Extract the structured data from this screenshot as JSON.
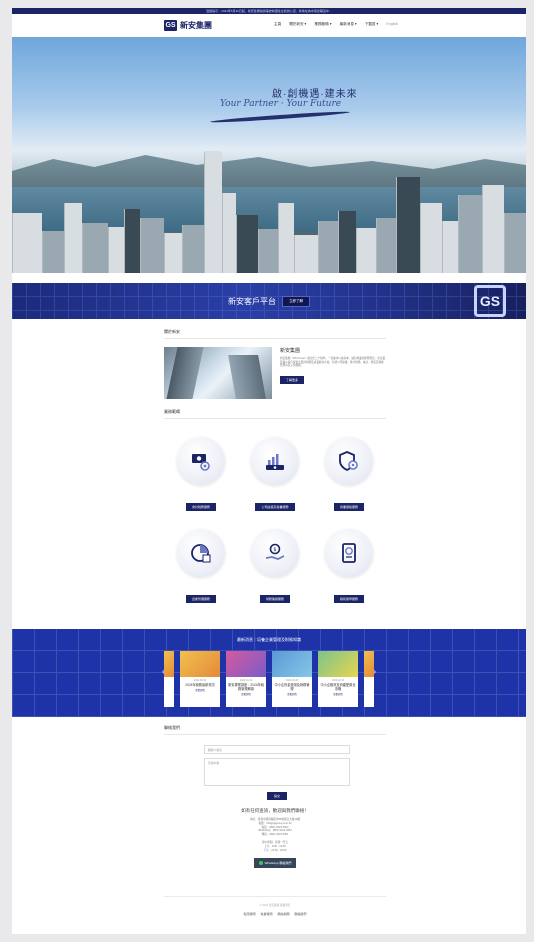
{
  "topbar": {
    "notice": "溫馨提示：2024年5月30日起，新安集團總辦事處將遷往全新辦公室，新地址為中環德輔道中…"
  },
  "header": {
    "logo_mark": "GS",
    "logo_text": "新安集團",
    "nav": [
      "主頁",
      "關於新安 ▾",
      "業務範疇 ▾",
      "最新消息 ▾",
      "下載區 ▾",
      "English"
    ]
  },
  "hero": {
    "title": "啟·創機遇·建未來",
    "subtitle": "Your Partner · Your Future"
  },
  "platform": {
    "title": "新安客戶平台",
    "button": "立即了解",
    "mark": "GS"
  },
  "about": {
    "section_title": "關於新安",
    "heading": "新安集團",
    "body": "新安集團（GS Group）成立於二十餘年，一直秉承以客為本、誠信專業的經營理念，為企業及個人客戶提供全面的財務及商業解決方案，包括公司秘書、會計稅務、審計、移民及資產管理等多元化服務。",
    "button": "了解更多"
  },
  "services": {
    "section_title": "業務範疇",
    "items": [
      {
        "label": "會計稅務服務",
        "icon": "coins-gear-icon"
      },
      {
        "label": "公司註冊及秘書服務",
        "icon": "bar-chart-money-icon"
      },
      {
        "label": "商業保險服務",
        "icon": "shield-gear-icon"
      },
      {
        "label": "資產管理服務",
        "icon": "pie-chart-icon"
      },
      {
        "label": "財務策劃服務",
        "icon": "hand-coin-icon"
      },
      {
        "label": "移民留學服務",
        "icon": "passport-icon"
      }
    ]
  },
  "news": {
    "title": "最新消息｜培養企業管理及財務知識",
    "cards": [
      {
        "date": "2024-05-20",
        "title": "2024年稅務最新資訊",
        "more": "查看詳情"
      },
      {
        "date": "2024-04-16",
        "title": "新安專業講座：2024年稅務新規解讀",
        "more": "查看詳情"
      },
      {
        "date": "2024-03-28",
        "title": "中小企資金運用及財務管理",
        "more": "查看詳情"
      },
      {
        "date": "2024-02-10",
        "title": "中小企融資及資產配置全攻略",
        "more": "查看詳情"
      }
    ]
  },
  "contact": {
    "section_title": "聯絡我們",
    "name_placeholder": "聯絡人姓名",
    "message_placeholder": "查詢內容",
    "submit": "提交",
    "heading": "如有任何查詢，歡迎與我們聯絡！",
    "lines": [
      "地址：香港中環德輔道中68號萬宜大廈19樓",
      "電郵：info@gsgroup.com.hk",
      "電話：(852) 2523 6000",
      "WhatsApp：(852) 9123 4567",
      "傳真：(852) 2523 6001"
    ],
    "hours": [
      "辦公時間：星期一至五",
      "上午：9:00 - 13:00",
      "下午：14:00 - 18:00"
    ],
    "whatsapp_button": "WhatsApp 聯絡我們"
  },
  "footer": {
    "copyright": "© 2024 新安集團 版權所有",
    "links": [
      "私隱聲明",
      "免責聲明",
      "網站地圖",
      "聯絡我們"
    ]
  }
}
